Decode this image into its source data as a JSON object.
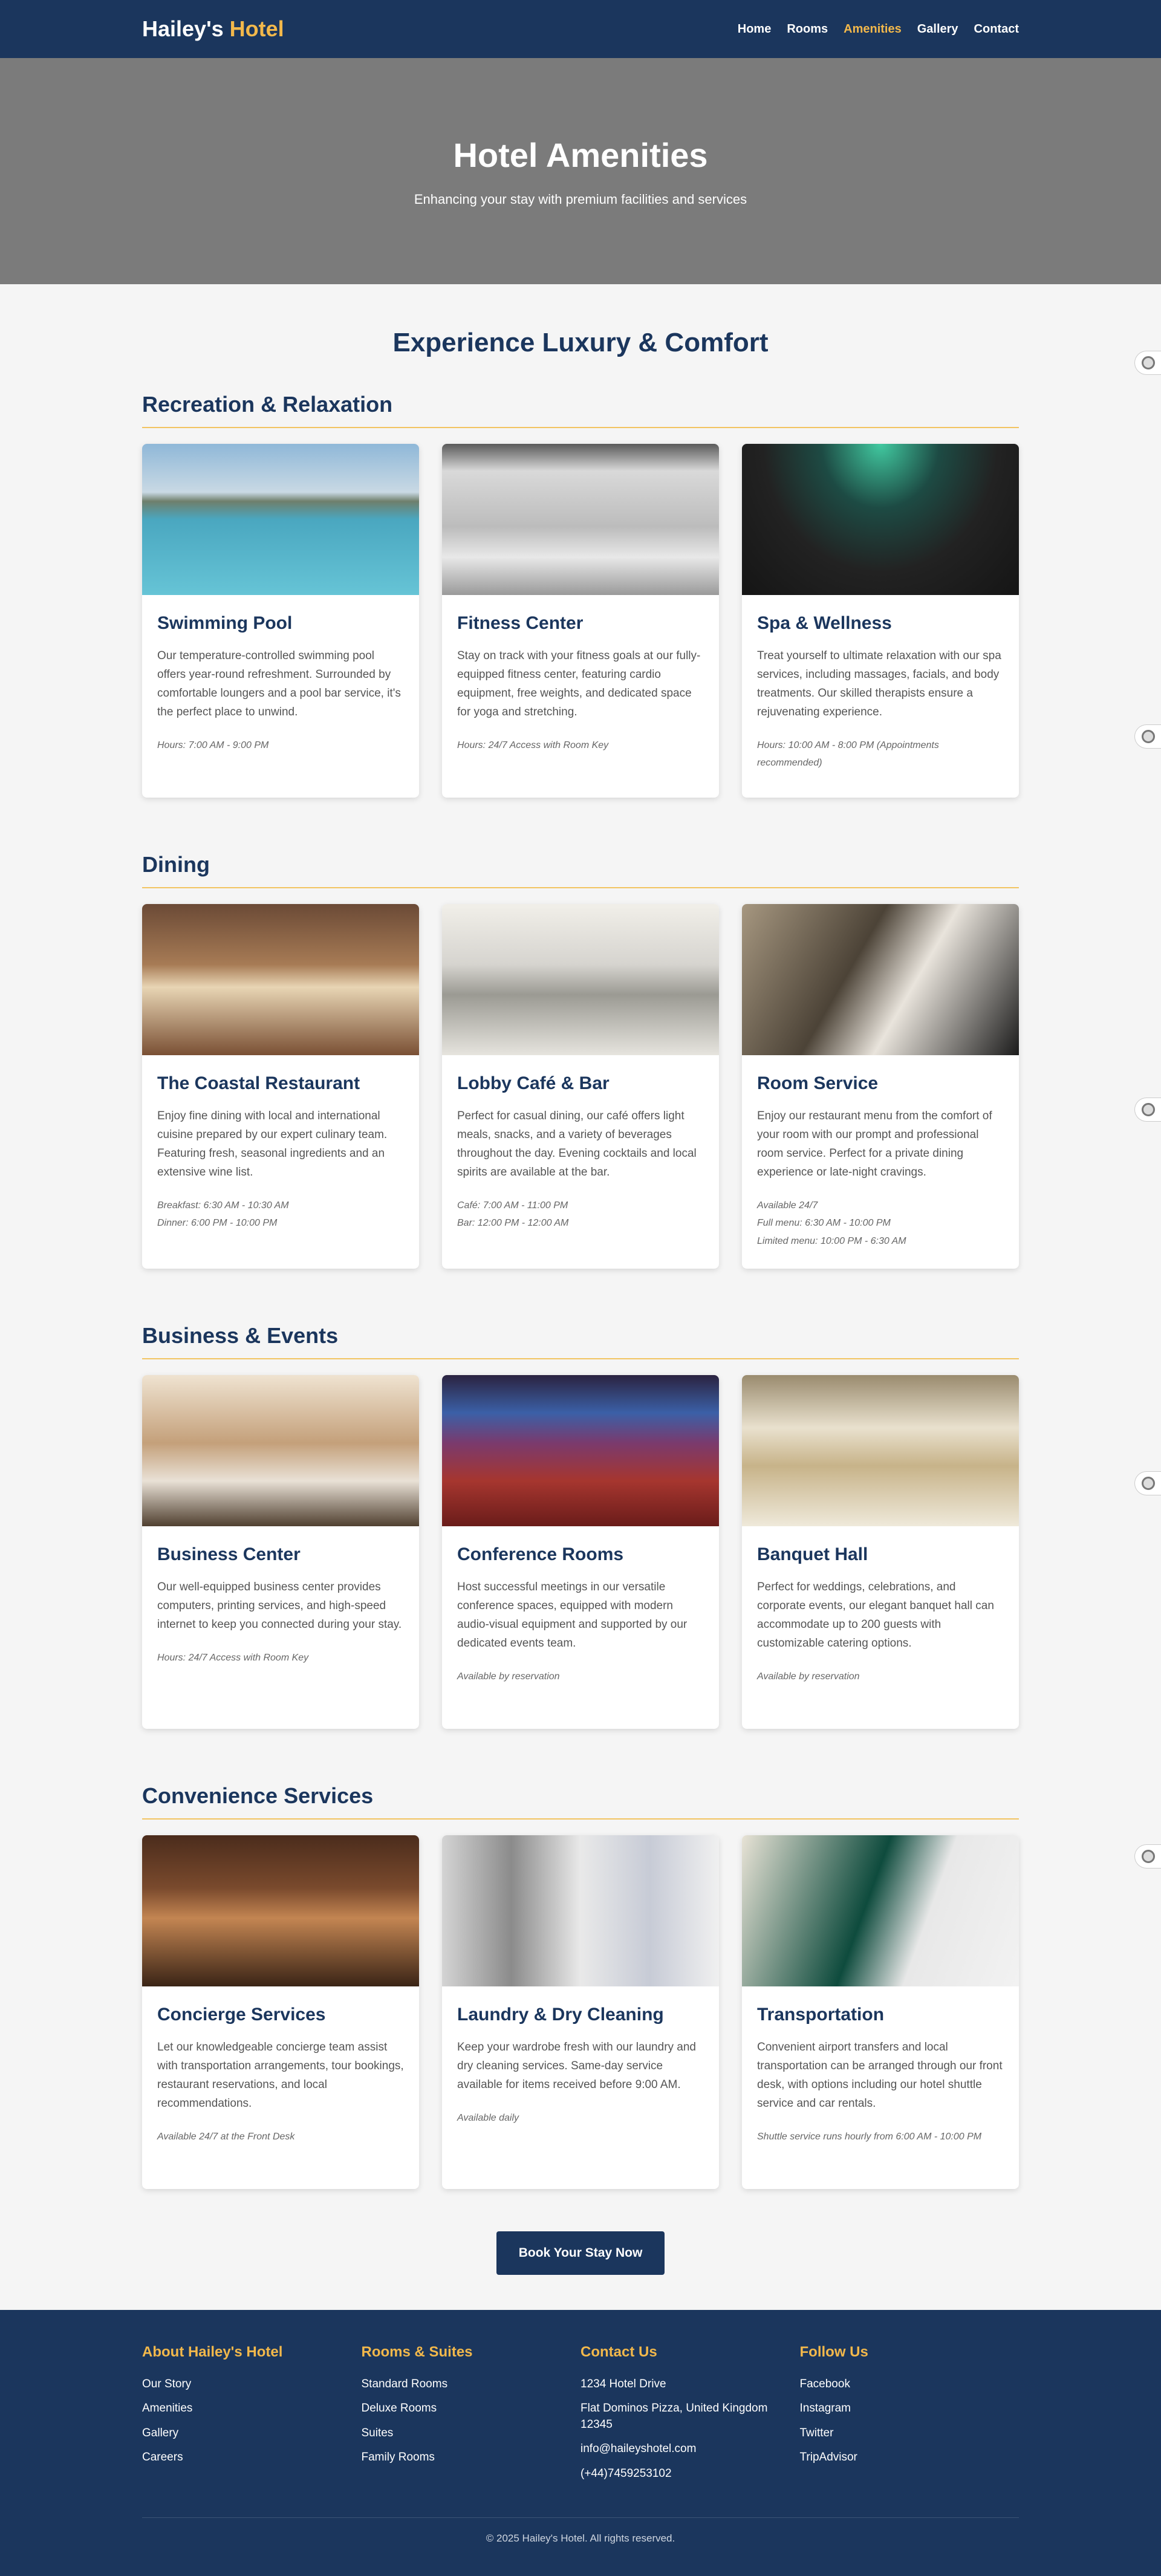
{
  "brand": {
    "name": "Hailey's",
    "accent": "Hotel"
  },
  "nav": {
    "items": [
      {
        "label": "Home",
        "active": false
      },
      {
        "label": "Rooms",
        "active": false
      },
      {
        "label": "Amenities",
        "active": true
      },
      {
        "label": "Gallery",
        "active": false
      },
      {
        "label": "Contact",
        "active": false
      }
    ]
  },
  "hero": {
    "title": "Hotel Amenities",
    "subtitle": "Enhancing your stay with premium facilities and services"
  },
  "main": {
    "heading": "Experience Luxury & Comfort",
    "sections": [
      {
        "title": "Recreation & Relaxation",
        "cards": [
          {
            "image": "img-pool",
            "title": "Swimming Pool",
            "description": "Our temperature-controlled swimming pool offers year-round refreshment. Surrounded by comfortable loungers and a pool bar service, it's the perfect place to unwind.",
            "hours": [
              "Hours: 7:00 AM - 9:00 PM"
            ]
          },
          {
            "image": "img-gym",
            "title": "Fitness Center",
            "description": "Stay on track with your fitness goals at our fully-equipped fitness center, featuring cardio equipment, free weights, and dedicated space for yoga and stretching.",
            "hours": [
              "Hours: 24/7 Access with Room Key"
            ]
          },
          {
            "image": "img-spa",
            "title": "Spa & Wellness",
            "description": "Treat yourself to ultimate relaxation with our spa services, including massages, facials, and body treatments. Our skilled therapists ensure a rejuvenating experience.",
            "hours": [
              "Hours: 10:00 AM - 8:00 PM (Appointments recommended)"
            ]
          }
        ]
      },
      {
        "title": "Dining",
        "cards": [
          {
            "image": "img-restaurant",
            "title": "The Coastal Restaurant",
            "description": "Enjoy fine dining with local and international cuisine prepared by our expert culinary team. Featuring fresh, seasonal ingredients and an extensive wine list.",
            "hours": [
              "Breakfast: 6:30 AM - 10:30 AM",
              "Dinner: 6:00 PM - 10:00 PM"
            ]
          },
          {
            "image": "img-cafe",
            "title": "Lobby Café & Bar",
            "description": "Perfect for casual dining, our café offers light meals, snacks, and a variety of beverages throughout the day. Evening cocktails and local spirits are available at the bar.",
            "hours": [
              "Café: 7:00 AM - 11:00 PM",
              "Bar: 12:00 PM - 12:00 AM"
            ]
          },
          {
            "image": "img-room",
            "title": "Room Service",
            "description": "Enjoy our restaurant menu from the comfort of your room with our prompt and professional room service. Perfect for a private dining experience or late-night cravings.",
            "hours": [
              "Available 24/7",
              "Full menu: 6:30 AM - 10:00 PM",
              "Limited menu: 10:00 PM - 6:30 AM"
            ]
          }
        ]
      },
      {
        "title": "Business & Events",
        "cards": [
          {
            "image": "img-business",
            "title": "Business Center",
            "description": "Our well-equipped business center provides computers, printing services, and high-speed internet to keep you connected during your stay.",
            "hours": [
              "Hours: 24/7 Access with Room Key"
            ]
          },
          {
            "image": "img-conference",
            "title": "Conference Rooms",
            "description": "Host successful meetings in our versatile conference spaces, equipped with modern audio-visual equipment and supported by our dedicated events team.",
            "hours": [
              "Available by reservation"
            ]
          },
          {
            "image": "img-banquet",
            "title": "Banquet Hall",
            "description": "Perfect for weddings, celebrations, and corporate events, our elegant banquet hall can accommodate up to 200 guests with customizable catering options.",
            "hours": [
              "Available by reservation"
            ]
          }
        ]
      },
      {
        "title": "Convenience Services",
        "cards": [
          {
            "image": "img-concierge",
            "title": "Concierge Services",
            "description": "Let our knowledgeable concierge team assist with transportation arrangements, tour bookings, restaurant reservations, and local recommendations.",
            "hours": [
              "Available 24/7 at the Front Desk"
            ]
          },
          {
            "image": "img-laundry",
            "title": "Laundry & Dry Cleaning",
            "description": "Keep your wardrobe fresh with our laundry and dry cleaning services. Same-day service available for items received before 9:00 AM.",
            "hours": [
              "Available daily"
            ]
          },
          {
            "image": "img-transport",
            "title": "Transportation",
            "description": "Convenient airport transfers and local transportation can be arranged through our front desk, with options including our hotel shuttle service and car rentals.",
            "hours": [
              "Shuttle service runs hourly from 6:00 AM - 10:00 PM"
            ]
          }
        ]
      }
    ],
    "cta_label": "Book Your Stay Now"
  },
  "footer": {
    "columns": [
      {
        "heading": "About Hailey's Hotel",
        "links": [
          "Our Story",
          "Amenities",
          "Gallery",
          "Careers"
        ]
      },
      {
        "heading": "Rooms & Suites",
        "links": [
          "Standard Rooms",
          "Deluxe Rooms",
          "Suites",
          "Family Rooms"
        ]
      },
      {
        "heading": "Contact Us",
        "links": [
          "1234 Hotel Drive",
          "Flat Dominos Pizza, United Kingdom 12345",
          "info@haileyshotel.com",
          "(+44)7459253102"
        ]
      },
      {
        "heading": "Follow Us",
        "links": [
          "Facebook",
          "Instagram",
          "Twitter",
          "TripAdvisor"
        ]
      }
    ],
    "copyright": "© 2025 Hailey's Hotel. All rights reserved."
  },
  "colors": {
    "navy": "#1b365d",
    "gold": "#f2b84b",
    "background": "#f5f5f5"
  }
}
